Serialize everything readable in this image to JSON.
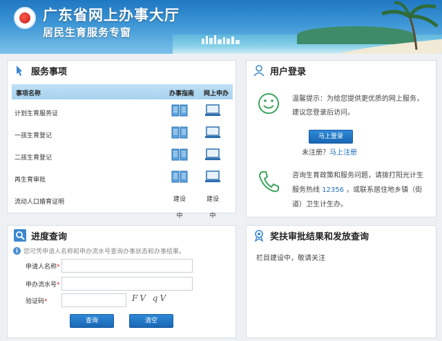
{
  "banner": {
    "title": "广东省网上办事大厅",
    "subtitle": "居民生育服务专窗"
  },
  "services": {
    "title": "服务事项",
    "columns": [
      "事项名称",
      "办事指南",
      "网上申办"
    ],
    "rows": [
      {
        "name": "计划生育服务证",
        "guide": "book-icon",
        "apply": "computer-icon"
      },
      {
        "name": "一孩生育登记",
        "guide": "book-icon",
        "apply": "computer-icon"
      },
      {
        "name": "二孩生育登记",
        "guide": "book-icon",
        "apply": "computer-icon"
      },
      {
        "name": "再生育审批",
        "guide": "book-icon",
        "apply": "computer-icon"
      },
      {
        "name": "流动人口婚育证明",
        "guide_text": "建设中",
        "apply_text": "建设中"
      }
    ]
  },
  "login": {
    "title": "用户登录",
    "tip_line1": "温馨提示：为给您提供更优质的网上服务，",
    "tip_line2": "建议您登录后访问。",
    "login_button": "马上登录",
    "unregistered": "未注册？",
    "register_link": "马上注册",
    "consult_line1": "咨询生育政策和服务问题，请拨打阳光计生",
    "consult_pre": "服务热线 ",
    "hotline": "12356",
    "consult_post": " ，或联系居住地乡镇（街",
    "consult_line3": "道）卫生计生办。"
  },
  "progress": {
    "title": "进度查询",
    "note": "您可凭申请人名称和申办流水号查询办事状态和办事结果。",
    "applicant_label": "申请人名称",
    "serial_label": "申办流水号",
    "captcha_label": "验证码",
    "required_mark": "*",
    "applicant_value": "",
    "serial_value": "",
    "captcha_value": "",
    "captcha_text": "FV qV",
    "query_button": "查询",
    "clear_button": "清空"
  },
  "award": {
    "title": "奖扶审批结果和发放查询",
    "text": "栏目建设中，敬请关注"
  },
  "colors": {
    "accent": "#1f6fb8",
    "button": "#1866b4",
    "table_header": "#bfe0f6"
  }
}
